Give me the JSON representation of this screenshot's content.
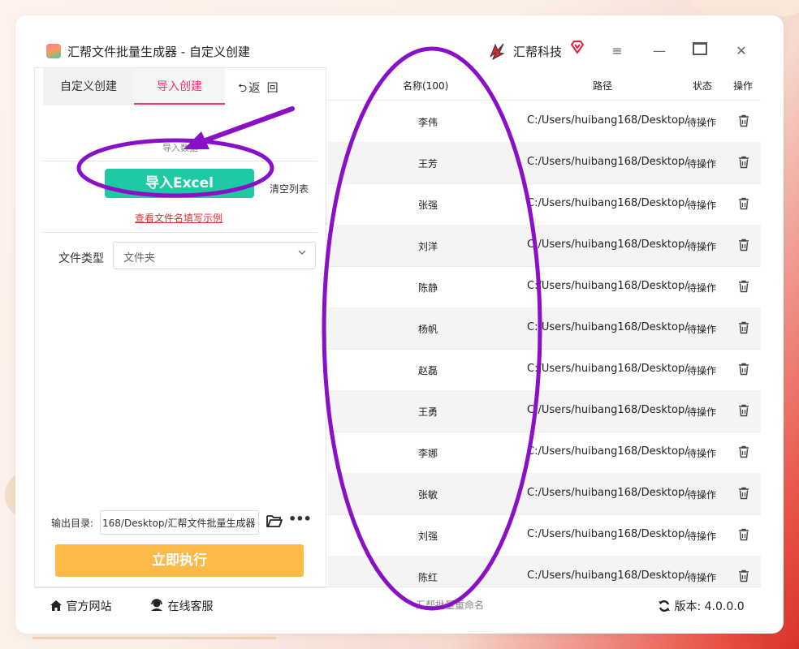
{
  "window": {
    "title": "汇帮文件批量生成器 - 自定义创建",
    "brand": "汇帮科技",
    "controls": {
      "menu": "≡",
      "minimize": "—",
      "close": "✕"
    }
  },
  "left": {
    "tabs": [
      {
        "label": "自定义创建"
      },
      {
        "label": "导入创建"
      }
    ],
    "back_label": "⮌返 回",
    "section_title": "导入数据",
    "import_button": "导入Excel",
    "clear_list": "清空列表",
    "example_link": "查看文件名填写示例",
    "file_type_label": "文件类型",
    "file_type_value": "文件夹",
    "output_label": "输出目录:",
    "output_value": "168/Desktop/汇帮文件批量生成器",
    "more": "•••",
    "run_button": "立即执行"
  },
  "table": {
    "headers": {
      "name": "名称(100)",
      "path": "路径",
      "status": "状态",
      "op": "操作"
    },
    "rows": [
      {
        "name": "李伟",
        "path": "C:/Users/huibang168/Desktop/",
        "status": "待操作"
      },
      {
        "name": "王芳",
        "path": "C:/Users/huibang168/Desktop/",
        "status": "待操作"
      },
      {
        "name": "张强",
        "path": "C:/Users/huibang168/Desktop/",
        "status": "待操作"
      },
      {
        "name": "刘洋",
        "path": "C:/Users/huibang168/Desktop/",
        "status": "待操作"
      },
      {
        "name": "陈静",
        "path": "C:/Users/huibang168/Desktop/",
        "status": "待操作"
      },
      {
        "name": "杨帆",
        "path": "C:/Users/huibang168/Desktop/",
        "status": "待操作"
      },
      {
        "name": "赵磊",
        "path": "C:/Users/huibang168/Desktop/",
        "status": "待操作"
      },
      {
        "name": "王勇",
        "path": "C:/Users/huibang168/Desktop/",
        "status": "待操作"
      },
      {
        "name": "李娜",
        "path": "C:/Users/huibang168/Desktop/",
        "status": "待操作"
      },
      {
        "name": "张敏",
        "path": "C:/Users/huibang168/Desktop/",
        "status": "待操作"
      },
      {
        "name": "刘强",
        "path": "C:/Users/huibang168/Desktop/",
        "status": "待操作"
      },
      {
        "name": "陈红",
        "path": "C:/Users/huibang168/Desktop/",
        "status": "待操作"
      }
    ]
  },
  "footer": {
    "home": "官方网站",
    "service": "在线客服",
    "center": "汇帮批量重命名",
    "version": "版本: 4.0.0.0"
  },
  "colors": {
    "accent_green": "#1fc9a4",
    "accent_pink": "#ee3a6a",
    "run_orange": "#feba49",
    "annotation_purple": "#8a10c8",
    "link_red": "#e53030"
  }
}
